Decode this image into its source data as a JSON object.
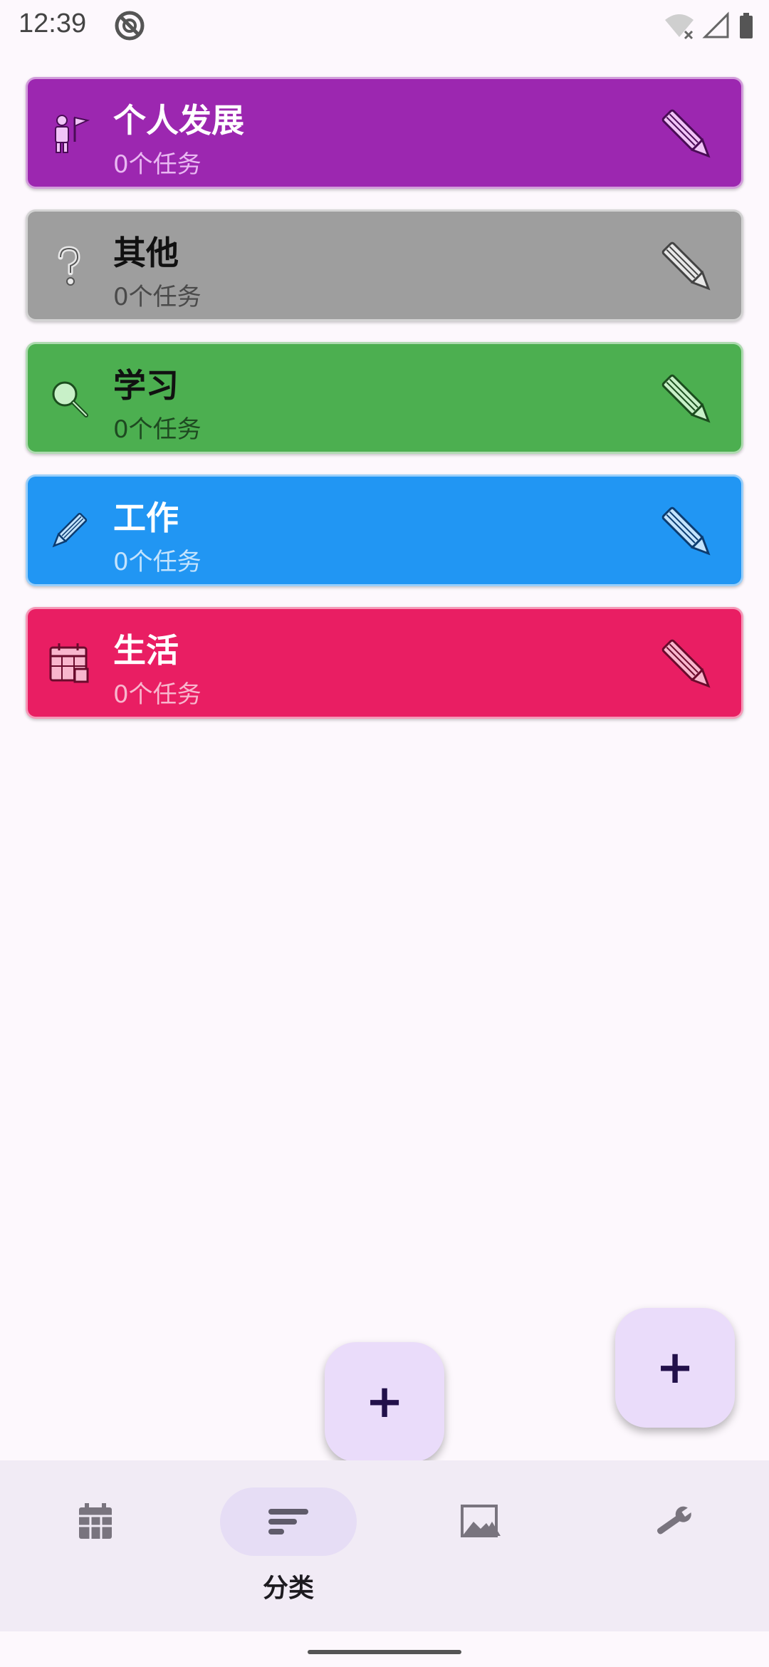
{
  "status_bar": {
    "time": "12:39"
  },
  "categories": [
    {
      "title": "个人发展",
      "count": "0个任务",
      "color": "#9c27b0",
      "title_color": "#ffffff",
      "count_color": "#e9b8f2",
      "icon": "personal-growth-icon"
    },
    {
      "title": "其他",
      "count": "0个任务",
      "color": "#9e9e9e",
      "title_color": "#111111",
      "count_color": "#4a4a4a",
      "icon": "question-mark-icon"
    },
    {
      "title": "学习",
      "count": "0个任务",
      "color": "#4caf50",
      "title_color": "#111111",
      "count_color": "#1e4a21",
      "icon": "magnifier-icon"
    },
    {
      "title": "工作",
      "count": "0个任务",
      "color": "#2196f3",
      "title_color": "#ffffff",
      "count_color": "#c3e3fd",
      "icon": "pencil-icon"
    },
    {
      "title": "生活",
      "count": "0个任务",
      "color": "#e91e63",
      "title_color": "#ffffff",
      "count_color": "#f8b6cd",
      "icon": "calendar-icon"
    }
  ],
  "fabs": {
    "add_symbol": "+"
  },
  "bottom_nav": {
    "items": [
      {
        "icon": "calendar-icon",
        "label": ""
      },
      {
        "icon": "sort-icon",
        "label": "分类",
        "active": true
      },
      {
        "icon": "image-icon",
        "label": ""
      },
      {
        "icon": "wrench-icon",
        "label": ""
      }
    ]
  }
}
